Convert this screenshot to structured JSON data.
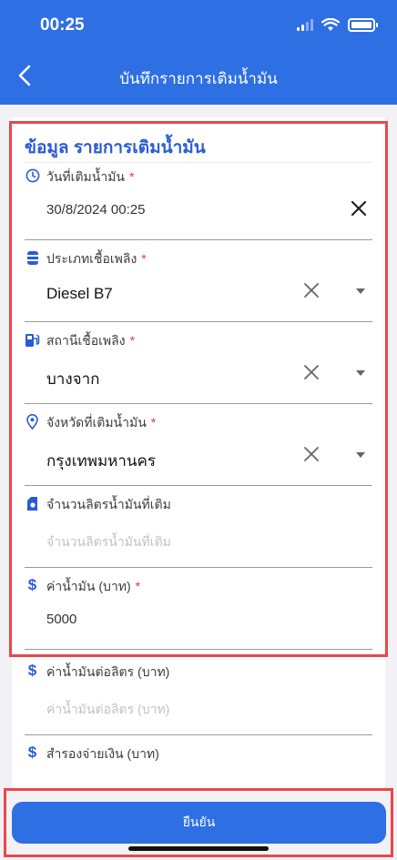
{
  "status_bar": {
    "time": "00:25"
  },
  "nav": {
    "title": "บันทึกรายการเติมน้ำมัน"
  },
  "section": {
    "title": "ข้อมูล รายการเติมน้ำมัน"
  },
  "fields": [
    {
      "label": "วันที่เติมน้ำมัน",
      "required": "*",
      "value": "30/8/2024 00:25",
      "icon": "clock-icon"
    },
    {
      "label": "ประเภทเชื้อเพลิง",
      "required": "*",
      "value": "Diesel B7",
      "icon": "fuel-barrel-icon"
    },
    {
      "label": "สถานีเชื้อเพลิง",
      "required": "*",
      "value": "บางจาก",
      "icon": "gas-station-icon"
    },
    {
      "label": "จังหวัดที่เติมน้ำมัน",
      "required": "*",
      "value": "กรุงเทพมหานคร",
      "icon": "location-pin-icon"
    },
    {
      "label": "จำนวนลิตรน้ำมันที่เติม",
      "placeholder": "จำนวนลิตรน้ำมันที่เติม",
      "icon": "fuel-can-icon"
    },
    {
      "label": "ค่าน้ำมัน (บาท)",
      "required": "*",
      "value": "5000",
      "icon": "dollar-icon"
    },
    {
      "label": "ค่าน้ำมันต่อลิตร (บาท)",
      "placeholder": "ค่าน้ำมันต่อลิตร (บาท)",
      "icon": "dollar-icon"
    },
    {
      "label": "สำรองจ่ายเงิน (บาท)",
      "icon": "dollar-icon"
    }
  ],
  "confirm_button": {
    "label": "ยืนยัน"
  },
  "colors": {
    "primary": "#2f6fe4",
    "title_blue": "#2a5bd7",
    "required_red": "#e53935",
    "highlight_red": "#e8484a"
  }
}
